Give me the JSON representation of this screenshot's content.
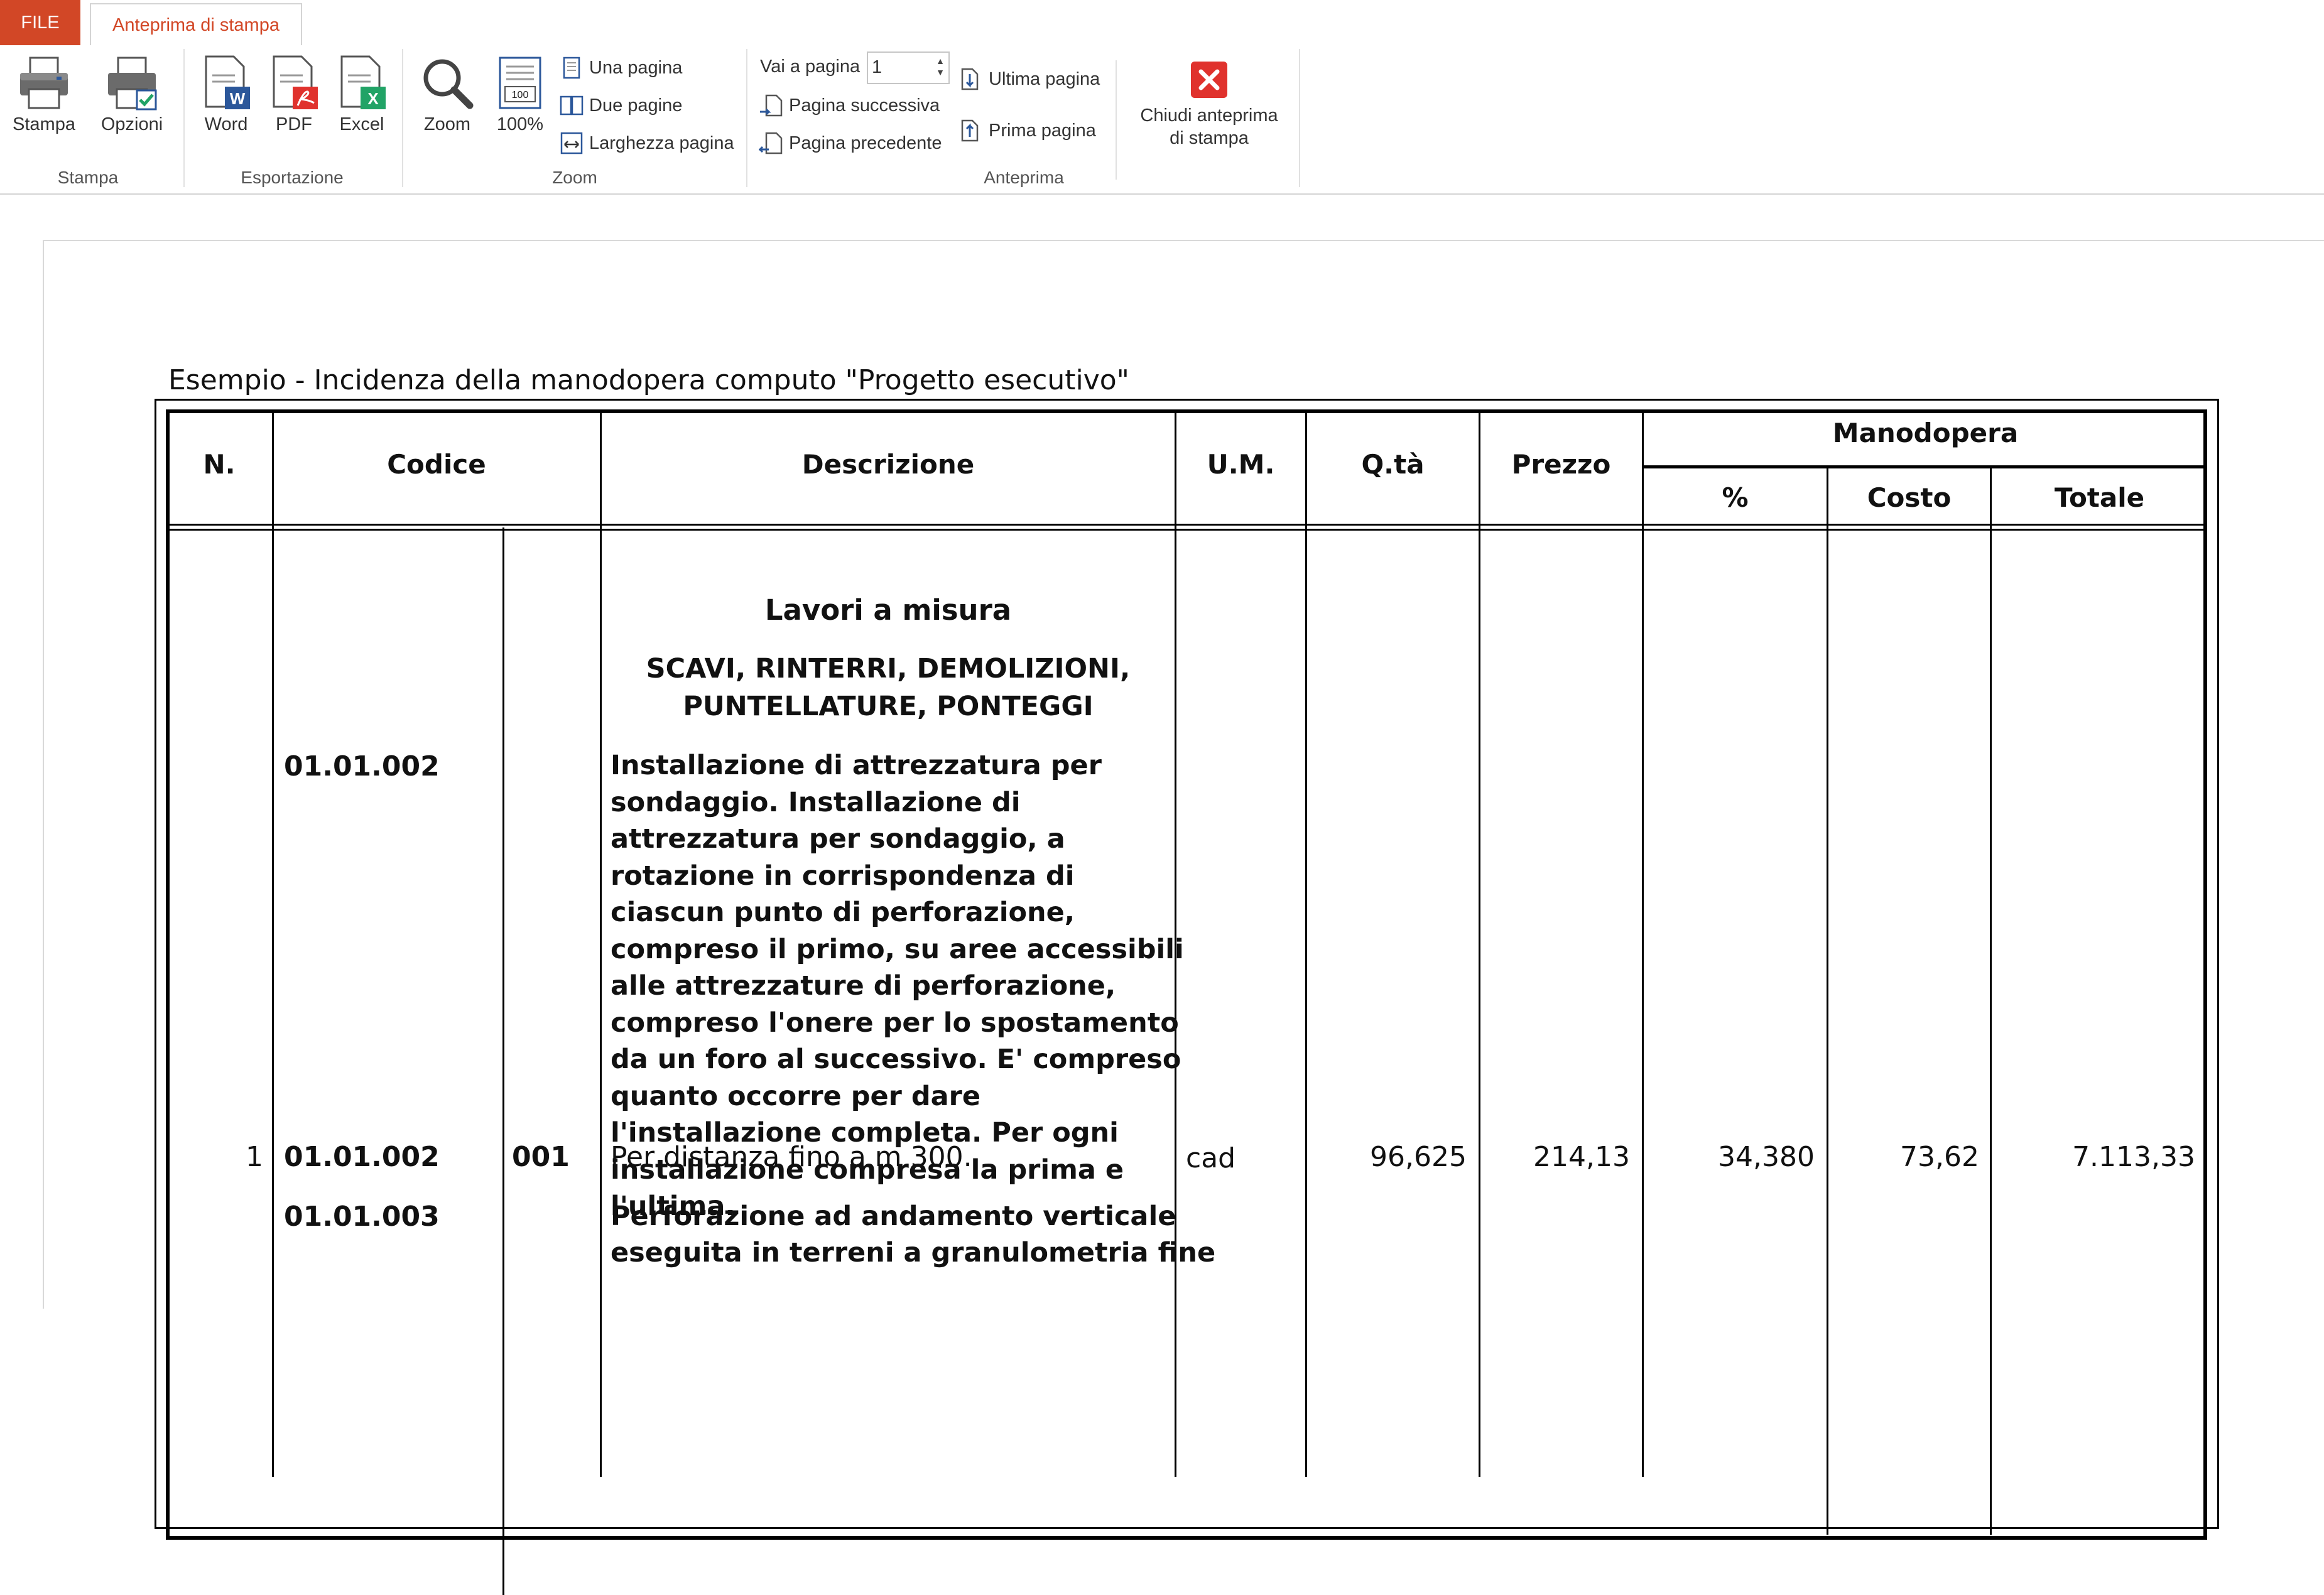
{
  "ribbon": {
    "tabs": [
      {
        "label": "FILE"
      },
      {
        "label": "Anteprima di stampa"
      }
    ],
    "groups": {
      "stampa": {
        "label": "Stampa",
        "print_label": "Stampa",
        "options_label": "Opzioni"
      },
      "esportazione": {
        "label": "Esportazione",
        "word_label": "Word",
        "pdf_label": "PDF",
        "excel_label": "Excel"
      },
      "zoom": {
        "label": "Zoom",
        "zoom_label": "Zoom",
        "hundred_label": "100%",
        "one_page": "Una pagina",
        "two_pages": "Due pagine",
        "page_width": "Larghezza pagina"
      },
      "anteprima": {
        "label": "Anteprima",
        "goto_label": "Vai a pagina",
        "goto_value": "1",
        "next_page": "Pagina successiva",
        "prev_page": "Pagina precedente",
        "last_page": "Ultima pagina",
        "first_page": "Prima pagina",
        "close_line1": "Chiudi anteprima",
        "close_line2": "di stampa"
      }
    },
    "colors": {
      "accent": "#d24726",
      "close_red": "#e0322d",
      "icon_blue": "#2b579a"
    }
  },
  "report": {
    "title": "Esempio - Incidenza della manodopera computo \"Progetto esecutivo\"",
    "headers": {
      "n": "N.",
      "codice": "Codice",
      "descrizione": "Descrizione",
      "um": "U.M.",
      "qta": "Q.tà",
      "prezzo": "Prezzo",
      "manodopera": "Manodopera",
      "perc": "%",
      "costo": "Costo",
      "totale": "Totale"
    },
    "section_title": "Lavori a misura",
    "category_line1": "SCAVI, RINTERRI, DEMOLIZIONI,",
    "category_line2": "PUNTELLATURE, PONTEGGI",
    "group_code": "01.01.002",
    "group_description": "Installazione di attrezzatura per sondaggio. Installazione di attrezzatura per sondaggio, a rotazione in corrispondenza di ciascun punto di perforazione, compreso il primo, su aree accessibili alle attrezzature di perforazione, compreso l'onere per lo spostamento da un foro al successivo. E' compreso quanto occorre per dare l'installazione completa. Per ogni installazione compresa la prima e l'ultima.",
    "row": {
      "n": "1",
      "codice": "01.01.002",
      "sub": "001",
      "descrizione": "Per distanza fino a m 300.",
      "um": "cad",
      "qta": "96,625",
      "prezzo": "214,13",
      "perc": "34,380",
      "costo": "73,62",
      "totale": "7.113,33"
    },
    "next_code": "01.01.003",
    "next_description_line1": "Perforazione ad andamento verticale",
    "next_description_line2": "eseguita in terreni a granulometria fine"
  }
}
